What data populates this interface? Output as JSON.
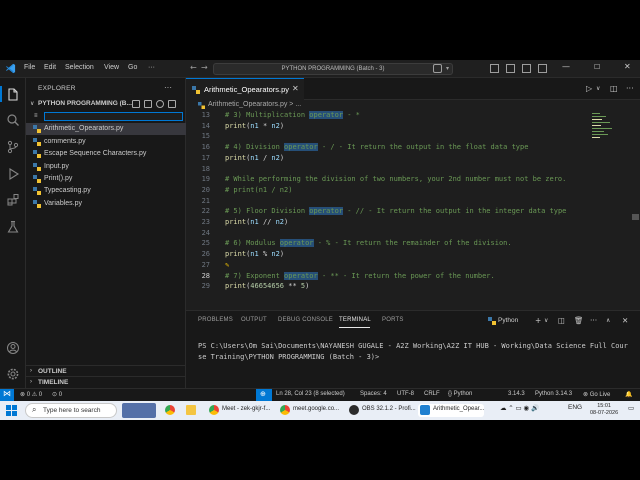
{
  "titlebar": {
    "menus": [
      "File",
      "Edit",
      "Selection",
      "View",
      "Go",
      "···"
    ],
    "search": "PYTHON PROGRAMMING (Batch - 3)"
  },
  "sidebar": {
    "title": "EXPLORER",
    "dots": "···",
    "folder": "PYTHON PROGRAMMING (B...",
    "files": [
      "Arithmetic_Opearators.py",
      "comments.py",
      "Escape Sequence Characters.py",
      "Input.py",
      "Print().py",
      "Typecasting.py",
      "Variables.py"
    ],
    "outline": "OUTLINE",
    "timeline": "TIMELINE"
  },
  "editor": {
    "tab": "Arithmetic_Opearators.py",
    "breadcrumb": "Arithmetic_Opearators.py > ..."
  },
  "code": {
    "line_numbers": [
      "13",
      "14",
      "15",
      "16",
      "17",
      "18",
      "19",
      "20",
      "21",
      "22",
      "23",
      "24",
      "25",
      "26",
      "27",
      "28",
      "29"
    ],
    "current_line": "28"
  },
  "panel": {
    "tabs": [
      "PROBLEMS",
      "OUTPUT",
      "DEBUG CONSOLE",
      "TERMINAL",
      "PORTS"
    ],
    "active_tab": "TERMINAL",
    "shell": "Python",
    "terminal_lines": [
      "PS C:\\Users\\Om Sai\\Documents\\NAYANESH GUGALE - A2Z Working\\A2Z IT HUB - Working\\Data Science Full Cour",
      "se Training\\PYTHON PROGRAMMING (Batch - 3)>"
    ]
  },
  "statusbar": {
    "errors": "⊗ 0 ⚠ 0",
    "ports": "⊙ 0",
    "position": "Ln 28, Col 23 (8 selected)",
    "spaces": "Spaces: 4",
    "encoding": "UTF-8",
    "eol": "CRLF",
    "language": "{} Python",
    "version": "3.14.3",
    "interpreter": "Python 3.14.3",
    "golive": "⊗ Go Live"
  },
  "taskbar": {
    "search": "Type here to search",
    "apps": [
      "Meet - zek-gkjr-f...",
      "meet.google.co...",
      "OBS 32.1.2 - Profi...",
      "Arithmetic_Opear..."
    ],
    "tray": "ENG",
    "time": "15:01",
    "date": "08-07-2026"
  },
  "colors": {
    "accent": "#0078d4",
    "comment": "#6a9955",
    "function": "#dcdcaa",
    "number": "#b5cea8"
  }
}
